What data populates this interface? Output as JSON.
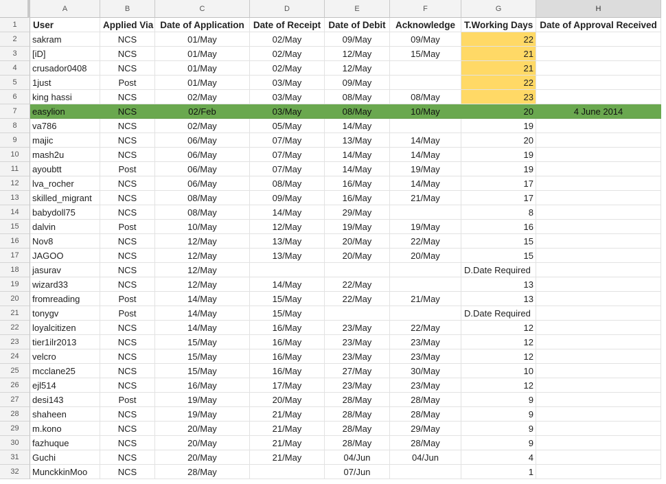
{
  "columns": [
    "A",
    "B",
    "C",
    "D",
    "E",
    "F",
    "G",
    "H"
  ],
  "selected_column": "H",
  "header": {
    "row_num": "1",
    "cells": [
      "User",
      "Applied Via",
      "Date of Application",
      "Date of Receipt",
      "Date of Debit",
      "Acknowledge",
      "T.Working Days",
      "Date of Approval Received"
    ]
  },
  "highlight_colors": {
    "approved_row": "#6aa84f",
    "working_days_flag": "#ffd966"
  },
  "rows": [
    {
      "n": "2",
      "user": "sakram",
      "via": "NCS",
      "app": "01/May",
      "rec": "02/May",
      "deb": "09/May",
      "ack": "09/May",
      "days": "22",
      "appr": "",
      "yellow": true
    },
    {
      "n": "3",
      "user": "[iD]",
      "via": "NCS",
      "app": "01/May",
      "rec": "02/May",
      "deb": "12/May",
      "ack": "15/May",
      "days": "21",
      "appr": "",
      "yellow": true
    },
    {
      "n": "4",
      "user": "crusador0408",
      "via": "NCS",
      "app": "01/May",
      "rec": "02/May",
      "deb": "12/May",
      "ack": "",
      "days": "21",
      "appr": "",
      "yellow": true
    },
    {
      "n": "5",
      "user": "1just",
      "via": "Post",
      "app": "01/May",
      "rec": "03/May",
      "deb": "09/May",
      "ack": "",
      "days": "22",
      "appr": "",
      "yellow": true
    },
    {
      "n": "6",
      "user": "king hassi",
      "via": "NCS",
      "app": "02/May",
      "rec": "03/May",
      "deb": "08/May",
      "ack": "08/May",
      "days": "23",
      "appr": "",
      "yellow": true
    },
    {
      "n": "7",
      "user": "easylion",
      "via": "NCS",
      "app": "02/Feb",
      "rec": "03/May",
      "deb": "08/May",
      "ack": "10/May",
      "days": "20",
      "appr": "4 June 2014",
      "highlight": true
    },
    {
      "n": "8",
      "user": "va786",
      "via": "NCS",
      "app": "02/May",
      "rec": "05/May",
      "deb": "14/May",
      "ack": "",
      "days": "19",
      "appr": ""
    },
    {
      "n": "9",
      "user": "majic",
      "via": "NCS",
      "app": "06/May",
      "rec": "07/May",
      "deb": "13/May",
      "ack": "14/May",
      "days": "20",
      "appr": ""
    },
    {
      "n": "10",
      "user": "mash2u",
      "via": "NCS",
      "app": "06/May",
      "rec": "07/May",
      "deb": "14/May",
      "ack": "14/May",
      "days": "19",
      "appr": ""
    },
    {
      "n": "11",
      "user": "ayoubtt",
      "via": "Post",
      "app": "06/May",
      "rec": "07/May",
      "deb": "14/May",
      "ack": "19/May",
      "days": "19",
      "appr": ""
    },
    {
      "n": "12",
      "user": "lva_rocher",
      "via": "NCS",
      "app": "06/May",
      "rec": "08/May",
      "deb": "16/May",
      "ack": "14/May",
      "days": "17",
      "appr": ""
    },
    {
      "n": "13",
      "user": "skilled_migrant",
      "via": "NCS",
      "app": "08/May",
      "rec": "09/May",
      "deb": "16/May",
      "ack": "21/May",
      "days": "17",
      "appr": ""
    },
    {
      "n": "14",
      "user": "babydoll75",
      "via": "NCS",
      "app": "08/May",
      "rec": "14/May",
      "deb": "29/May",
      "ack": "",
      "days": "8",
      "appr": ""
    },
    {
      "n": "15",
      "user": "dalvin",
      "via": "Post",
      "app": "10/May",
      "rec": "12/May",
      "deb": "19/May",
      "ack": "19/May",
      "days": "16",
      "appr": ""
    },
    {
      "n": "16",
      "user": "Nov8",
      "via": "NCS",
      "app": "12/May",
      "rec": "13/May",
      "deb": "20/May",
      "ack": "22/May",
      "days": "15",
      "appr": ""
    },
    {
      "n": "17",
      "user": "JAGOO",
      "via": "NCS",
      "app": "12/May",
      "rec": "13/May",
      "deb": "20/May",
      "ack": "20/May",
      "days": "15",
      "appr": ""
    },
    {
      "n": "18",
      "user": "jasurav",
      "via": "NCS",
      "app": "12/May",
      "rec": "",
      "deb": "",
      "ack": "",
      "days": "D.Date Required",
      "appr": "",
      "days_left": true
    },
    {
      "n": "19",
      "user": "wizard33",
      "via": "NCS",
      "app": "12/May",
      "rec": "14/May",
      "deb": "22/May",
      "ack": "",
      "days": "13",
      "appr": ""
    },
    {
      "n": "20",
      "user": "fromreading",
      "via": "Post",
      "app": "14/May",
      "rec": "15/May",
      "deb": "22/May",
      "ack": "21/May",
      "days": "13",
      "appr": ""
    },
    {
      "n": "21",
      "user": "tonygv",
      "via": "Post",
      "app": "14/May",
      "rec": "15/May",
      "deb": "",
      "ack": "",
      "days": "D.Date Required",
      "appr": "",
      "days_left": true
    },
    {
      "n": "22",
      "user": "loyalcitizen",
      "via": "NCS",
      "app": "14/May",
      "rec": "16/May",
      "deb": "23/May",
      "ack": "22/May",
      "days": "12",
      "appr": ""
    },
    {
      "n": "23",
      "user": "tier1ilr2013",
      "via": "NCS",
      "app": "15/May",
      "rec": "16/May",
      "deb": "23/May",
      "ack": "23/May",
      "days": "12",
      "appr": ""
    },
    {
      "n": "24",
      "user": "velcro",
      "via": "NCS",
      "app": "15/May",
      "rec": "16/May",
      "deb": "23/May",
      "ack": "23/May",
      "days": "12",
      "appr": ""
    },
    {
      "n": "25",
      "user": "mcclane25",
      "via": "NCS",
      "app": "15/May",
      "rec": "16/May",
      "deb": "27/May",
      "ack": "30/May",
      "days": "10",
      "appr": ""
    },
    {
      "n": "26",
      "user": "ejl514",
      "via": "NCS",
      "app": "16/May",
      "rec": "17/May",
      "deb": "23/May",
      "ack": "23/May",
      "days": "12",
      "appr": ""
    },
    {
      "n": "27",
      "user": "desi143",
      "via": "Post",
      "app": "19/May",
      "rec": "20/May",
      "deb": "28/May",
      "ack": "28/May",
      "days": "9",
      "appr": ""
    },
    {
      "n": "28",
      "user": "shaheen",
      "via": "NCS",
      "app": "19/May",
      "rec": "21/May",
      "deb": "28/May",
      "ack": "28/May",
      "days": "9",
      "appr": ""
    },
    {
      "n": "29",
      "user": "m.kono",
      "via": "NCS",
      "app": "20/May",
      "rec": "21/May",
      "deb": "28/May",
      "ack": "29/May",
      "days": "9",
      "appr": ""
    },
    {
      "n": "30",
      "user": "fazhuque",
      "via": "NCS",
      "app": "20/May",
      "rec": "21/May",
      "deb": "28/May",
      "ack": "28/May",
      "days": "9",
      "appr": ""
    },
    {
      "n": "31",
      "user": "Guchi",
      "via": "NCS",
      "app": "20/May",
      "rec": "21/May",
      "deb": "04/Jun",
      "ack": "04/Jun",
      "days": "4",
      "appr": ""
    },
    {
      "n": "32",
      "user": "MunckkinMoo",
      "via": "NCS",
      "app": "28/May",
      "rec": "",
      "deb": "07/Jun",
      "ack": "",
      "days": "1",
      "appr": ""
    }
  ]
}
